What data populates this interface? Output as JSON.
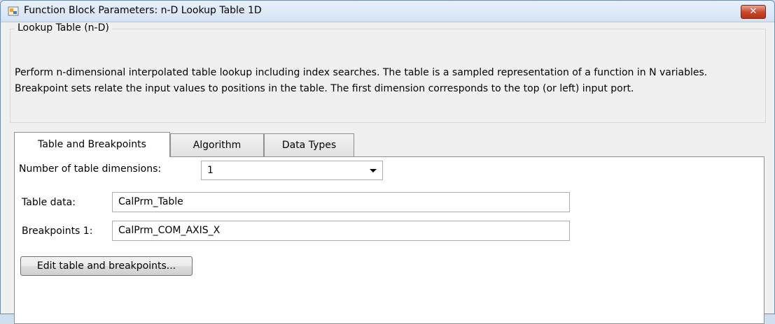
{
  "window": {
    "title": "Function Block Parameters: n-D Lookup Table 1D",
    "close_label": "✕"
  },
  "group": {
    "title": "Lookup Table (n-D)",
    "description": "Perform n-dimensional interpolated table lookup including index searches. The table is a sampled representation of a function in N variables. Breakpoint sets relate the input values to positions in the table. The first dimension corresponds to the top (or left) input port."
  },
  "tabs": [
    {
      "label": "Table and Breakpoints",
      "active": true
    },
    {
      "label": "Algorithm",
      "active": false
    },
    {
      "label": "Data Types",
      "active": false
    }
  ],
  "form": {
    "dimensions_label": "Number of table dimensions:",
    "dimensions_value": "1",
    "table_data_label": "Table data:",
    "table_data_value": "CalPrm_Table",
    "breakpoints1_label": "Breakpoints 1:",
    "breakpoints1_value": "CalPrm_COM_AXIS_X",
    "edit_button_label": "Edit table and breakpoints..."
  },
  "icons": {
    "app": "simulink-block-icon",
    "close": "close-icon",
    "dropdown": "chevron-down-icon"
  }
}
